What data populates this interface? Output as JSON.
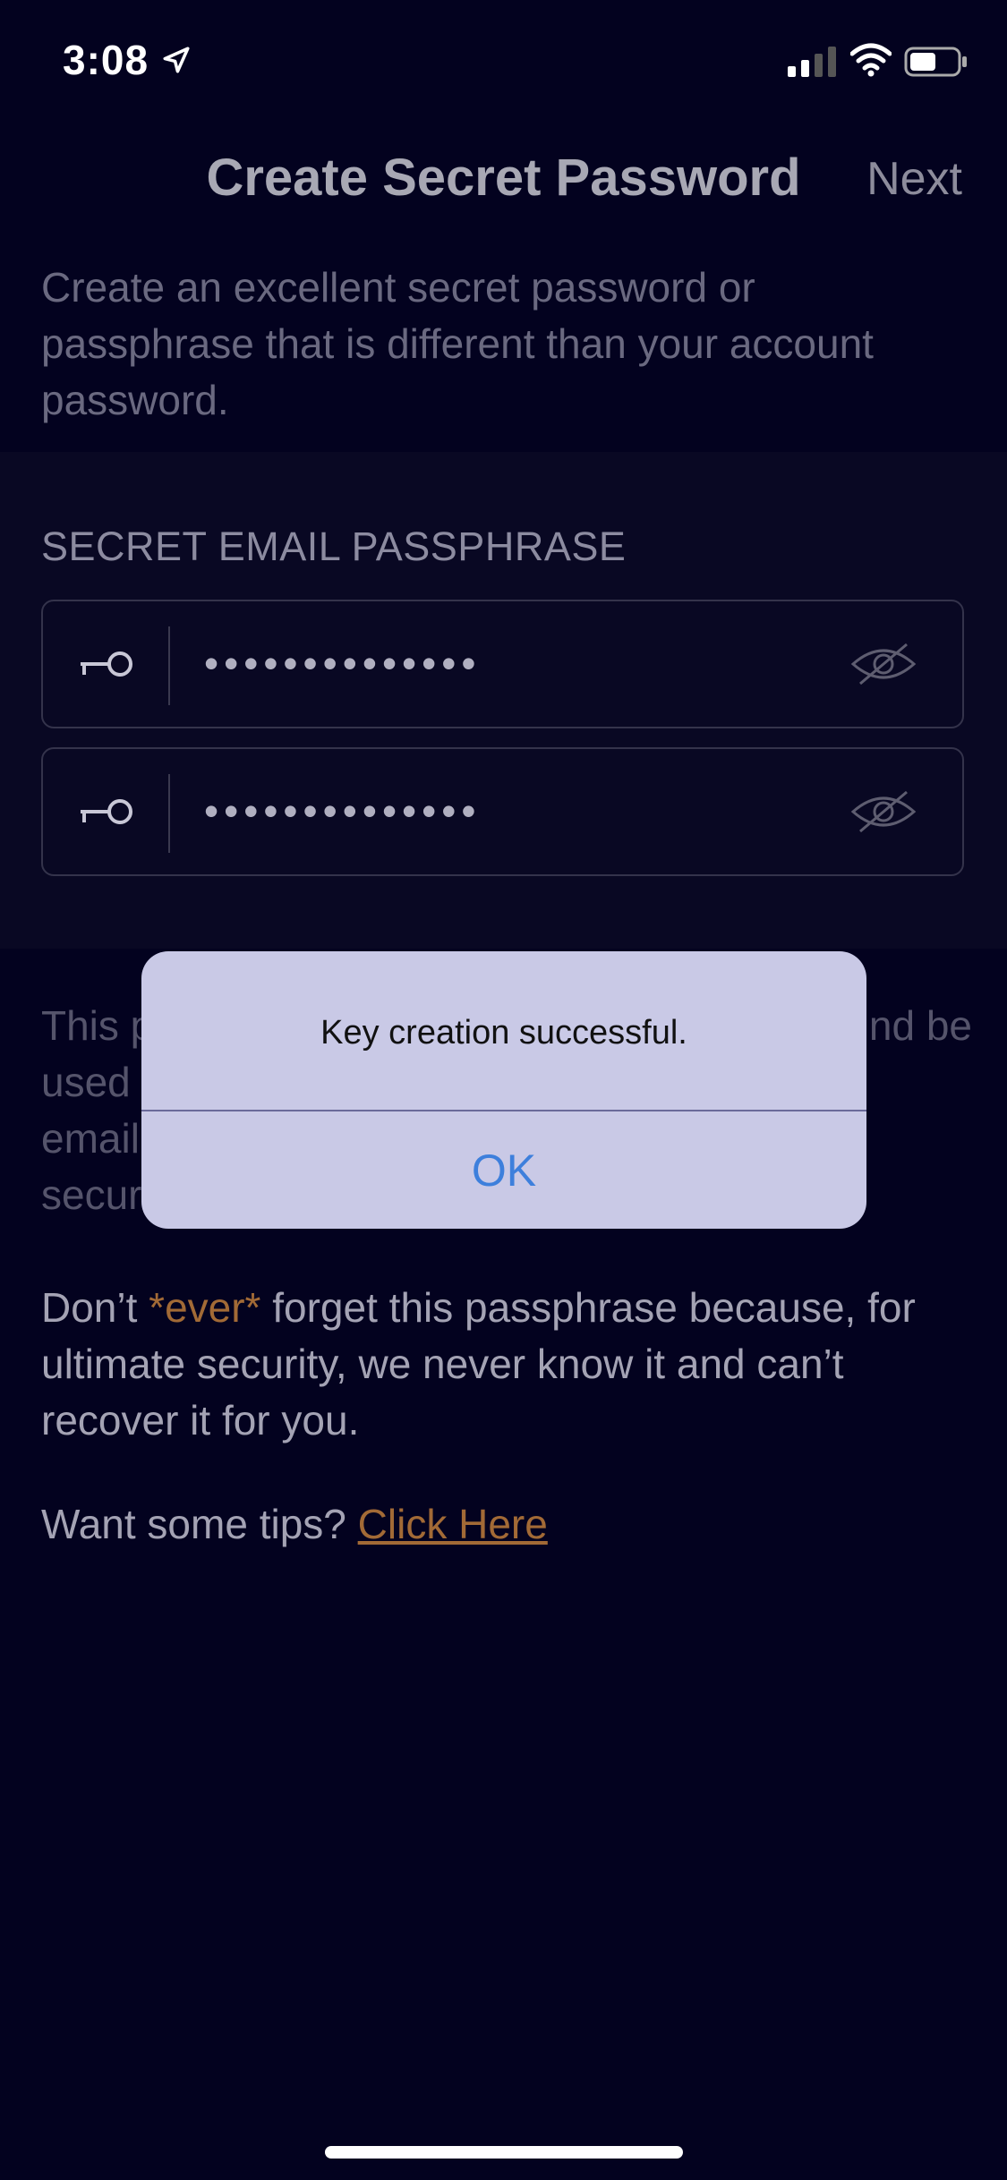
{
  "status_bar": {
    "time": "3:08"
  },
  "nav": {
    "title": "Create Secret Password",
    "next_label": "Next"
  },
  "intro_text": "Create an excellent secret password or passphrase that is different than your account password.",
  "section": {
    "label": "SECRET EMAIL PASSPHRASE",
    "fields": [
      {
        "value_masked": "••••••••••••••"
      },
      {
        "value_masked": "••••••••••••••"
      }
    ]
  },
  "body": {
    "para1_visible": [
      "This p",
      "nd be",
      "used",
      "email",
      "secur"
    ],
    "para2_prefix": "Don’t ",
    "para2_emphasis": "*ever*",
    "para2_suffix": " forget this passphrase because, for ultimate security, we never know it and can’t recover it for you.",
    "tips_prefix": "Want some tips? ",
    "tips_link": "Click Here"
  },
  "alert": {
    "message": "Key creation successful.",
    "ok_label": "OK"
  },
  "colors": {
    "background": "#03021f",
    "accent_orange": "#a26a36",
    "alert_button_blue": "#3d7fdc"
  }
}
